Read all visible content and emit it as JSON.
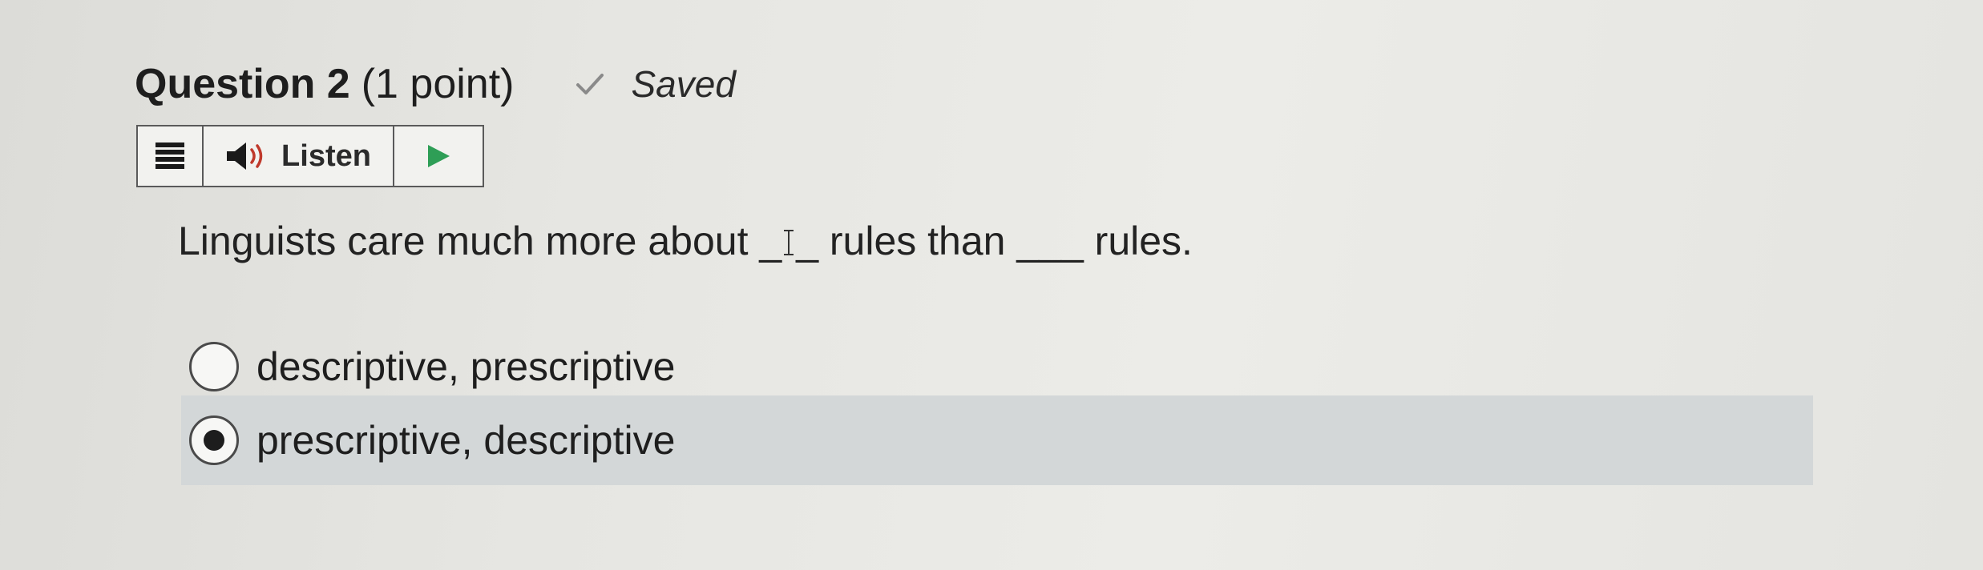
{
  "question": {
    "title": "Question 2",
    "points": "(1 point)",
    "status": "Saved",
    "text": "Linguists care much more about ___ rules than ___ rules.",
    "text_before": "Linguists care much more about _",
    "text_after": "_ rules than ___ rules."
  },
  "toolbar": {
    "menu_icon": "menu-icon",
    "listen_label": "Listen",
    "speaker_icon": "speaker-icon",
    "play_icon": "play-icon"
  },
  "options": [
    {
      "label": "descriptive, prescriptive",
      "selected": false
    },
    {
      "label": "prescriptive, descriptive",
      "selected": true
    }
  ],
  "colors": {
    "selected_row": "#d3d7d8",
    "check": "#8a8a8a",
    "play": "#2e9e56"
  }
}
